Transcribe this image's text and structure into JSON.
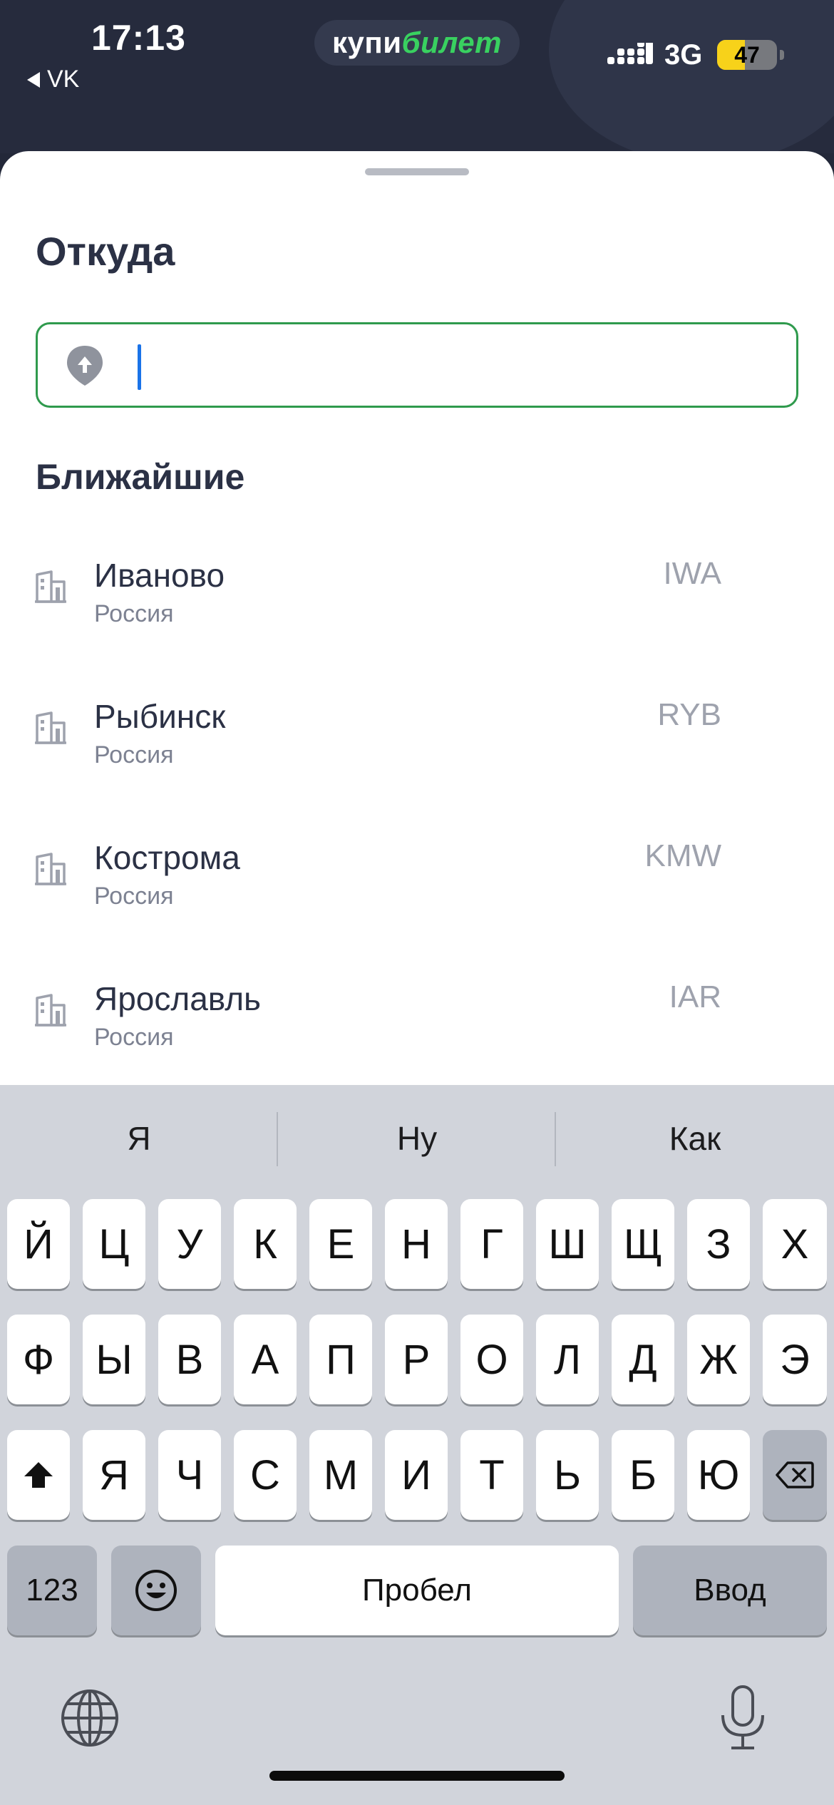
{
  "status_bar": {
    "time": "17:13",
    "back_label": "VK",
    "network": "3G",
    "battery": "47",
    "battery_level": 0.47
  },
  "brand": {
    "part1": "купи",
    "part2": "билет"
  },
  "sheet": {
    "title": "Откуда",
    "search": {
      "value": "",
      "placeholder": ""
    },
    "section_title": "Ближайшие",
    "items": [
      {
        "city": "Иваново",
        "country": "Россия",
        "code": "IWA"
      },
      {
        "city": "Рыбинск",
        "country": "Россия",
        "code": "RYB"
      },
      {
        "city": "Кострома",
        "country": "Россия",
        "code": "KMW"
      },
      {
        "city": "Ярославль",
        "country": "Россия",
        "code": "IAR"
      }
    ]
  },
  "keyboard": {
    "suggestions": [
      "Я",
      "Ну",
      "Как"
    ],
    "row1": [
      "Й",
      "Ц",
      "У",
      "К",
      "Е",
      "Н",
      "Г",
      "Ш",
      "Щ",
      "З",
      "Х"
    ],
    "row2": [
      "Ф",
      "Ы",
      "В",
      "А",
      "П",
      "Р",
      "О",
      "Л",
      "Д",
      "Ж",
      "Э"
    ],
    "row3": [
      "Я",
      "Ч",
      "С",
      "М",
      "И",
      "Т",
      "Ь",
      "Б",
      "Ю"
    ],
    "numbers_label": "123",
    "space_label": "Пробел",
    "return_label": "Ввод"
  },
  "colors": {
    "accent_green": "#2f9a4d",
    "brand_green": "#39d160",
    "header_bg": "#262b3d",
    "caret_blue": "#1a73e8"
  }
}
